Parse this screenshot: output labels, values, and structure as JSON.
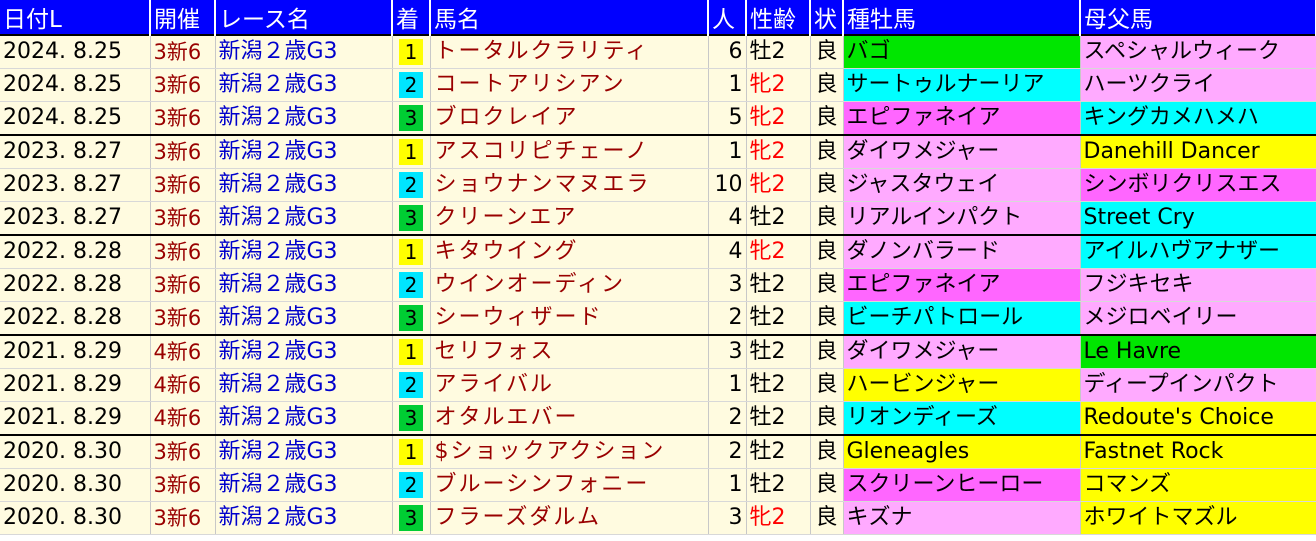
{
  "headers": [
    "日付L",
    "開催",
    "レース名",
    "着",
    "馬名",
    "人",
    "性齢",
    "状",
    "種牡馬",
    "母父馬"
  ],
  "colors": {
    "header_bg": "#0000ff",
    "row_bg": "#fffbe0",
    "rank1": "#ffff00",
    "rank2": "#00e6ff",
    "rank3": "#00cc33",
    "cyan": "#00ffff",
    "pink": "#ffaaff",
    "magenta": "#ff66ff",
    "yellow": "#ffff00",
    "green": "#00e600"
  },
  "rows": [
    {
      "date": "2024. 8.25",
      "kai": "3新6",
      "race": "新潟２歳G3",
      "rank": "1",
      "rank_color": "#ffff00",
      "horse": "トータルクラリティ",
      "pop": "6",
      "sex": "牡2",
      "filly": false,
      "baba": "良",
      "sire": "バゴ",
      "sire_color": "#00e600",
      "dam": "スペシャルウィーク",
      "dam_color": "#ffaaff",
      "grp": true
    },
    {
      "date": "2024. 8.25",
      "kai": "3新6",
      "race": "新潟２歳G3",
      "rank": "2",
      "rank_color": "#00e6ff",
      "horse": "コートアリシアン",
      "pop": "1",
      "sex": "牝2",
      "filly": true,
      "baba": "良",
      "sire": "サートゥルナーリア",
      "sire_color": "#00ffff",
      "dam": "ハーツクライ",
      "dam_color": "#ffaaff",
      "grp": false
    },
    {
      "date": "2024. 8.25",
      "kai": "3新6",
      "race": "新潟２歳G3",
      "rank": "3",
      "rank_color": "#00cc33",
      "horse": "ブロクレイア",
      "pop": "5",
      "sex": "牝2",
      "filly": true,
      "baba": "良",
      "sire": "エピファネイア",
      "sire_color": "#ff66ff",
      "dam": "キングカメハメハ",
      "dam_color": "#00ffff",
      "grp": false
    },
    {
      "date": "2023. 8.27",
      "kai": "3新6",
      "race": "新潟２歳G3",
      "rank": "1",
      "rank_color": "#ffff00",
      "horse": "アスコリピチェーノ",
      "pop": "1",
      "sex": "牝2",
      "filly": true,
      "baba": "良",
      "sire": "ダイワメジャー",
      "sire_color": "#ffaaff",
      "dam": "Danehill Dancer",
      "dam_color": "#ffff00",
      "grp": true
    },
    {
      "date": "2023. 8.27",
      "kai": "3新6",
      "race": "新潟２歳G3",
      "rank": "2",
      "rank_color": "#00e6ff",
      "horse": "ショウナンマヌエラ",
      "pop": "10",
      "sex": "牝2",
      "filly": true,
      "baba": "良",
      "sire": "ジャスタウェイ",
      "sire_color": "#ffaaff",
      "dam": "シンボリクリスエス",
      "dam_color": "#ff66ff",
      "grp": false
    },
    {
      "date": "2023. 8.27",
      "kai": "3新6",
      "race": "新潟２歳G3",
      "rank": "3",
      "rank_color": "#00cc33",
      "horse": "クリーンエア",
      "pop": "4",
      "sex": "牡2",
      "filly": false,
      "baba": "良",
      "sire": "リアルインパクト",
      "sire_color": "#ffaaff",
      "dam": "Street Cry",
      "dam_color": "#00ffff",
      "grp": false
    },
    {
      "date": "2022. 8.28",
      "kai": "3新6",
      "race": "新潟２歳G3",
      "rank": "1",
      "rank_color": "#ffff00",
      "horse": "キタウイング",
      "pop": "4",
      "sex": "牝2",
      "filly": true,
      "baba": "良",
      "sire": "ダノンバラード",
      "sire_color": "#ffaaff",
      "dam": "アイルハヴアナザー",
      "dam_color": "#00ffff",
      "grp": true
    },
    {
      "date": "2022. 8.28",
      "kai": "3新6",
      "race": "新潟２歳G3",
      "rank": "2",
      "rank_color": "#00e6ff",
      "horse": "ウインオーディン",
      "pop": "3",
      "sex": "牡2",
      "filly": false,
      "baba": "良",
      "sire": "エピファネイア",
      "sire_color": "#ff66ff",
      "dam": "フジキセキ",
      "dam_color": "#ffaaff",
      "grp": false
    },
    {
      "date": "2022. 8.28",
      "kai": "3新6",
      "race": "新潟２歳G3",
      "rank": "3",
      "rank_color": "#00cc33",
      "horse": "シーウィザード",
      "pop": "2",
      "sex": "牡2",
      "filly": false,
      "baba": "良",
      "sire": "ビーチパトロール",
      "sire_color": "#00ffff",
      "dam": "メジロベイリー",
      "dam_color": "#ffaaff",
      "grp": false
    },
    {
      "date": "2021. 8.29",
      "kai": "4新6",
      "race": "新潟２歳G3",
      "rank": "1",
      "rank_color": "#ffff00",
      "horse": "セリフォス",
      "pop": "3",
      "sex": "牡2",
      "filly": false,
      "baba": "良",
      "sire": "ダイワメジャー",
      "sire_color": "#ffaaff",
      "dam": "Le Havre",
      "dam_color": "#00e600",
      "grp": true
    },
    {
      "date": "2021. 8.29",
      "kai": "4新6",
      "race": "新潟２歳G3",
      "rank": "2",
      "rank_color": "#00e6ff",
      "horse": "アライバル",
      "pop": "1",
      "sex": "牡2",
      "filly": false,
      "baba": "良",
      "sire": "ハービンジャー",
      "sire_color": "#ffff00",
      "dam": "ディープインパクト",
      "dam_color": "#ffaaff",
      "grp": false
    },
    {
      "date": "2021. 8.29",
      "kai": "4新6",
      "race": "新潟２歳G3",
      "rank": "3",
      "rank_color": "#00cc33",
      "horse": "オタルエバー",
      "pop": "2",
      "sex": "牡2",
      "filly": false,
      "baba": "良",
      "sire": "リオンディーズ",
      "sire_color": "#00ffff",
      "dam": "Redoute's Choice",
      "dam_color": "#ffff00",
      "grp": false
    },
    {
      "date": "2020. 8.30",
      "kai": "3新6",
      "race": "新潟２歳G3",
      "rank": "1",
      "rank_color": "#ffff00",
      "horse": "$ショックアクション",
      "pop": "2",
      "sex": "牡2",
      "filly": false,
      "baba": "良",
      "sire": "Gleneagles",
      "sire_color": "#ffff00",
      "dam": "Fastnet Rock",
      "dam_color": "#ffff00",
      "grp": true
    },
    {
      "date": "2020. 8.30",
      "kai": "3新6",
      "race": "新潟２歳G3",
      "rank": "2",
      "rank_color": "#00e6ff",
      "horse": "ブルーシンフォニー",
      "pop": "1",
      "sex": "牡2",
      "filly": false,
      "baba": "良",
      "sire": "スクリーンヒーロー",
      "sire_color": "#ff66ff",
      "dam": "コマンズ",
      "dam_color": "#ffff00",
      "grp": false
    },
    {
      "date": "2020. 8.30",
      "kai": "3新6",
      "race": "新潟２歳G3",
      "rank": "3",
      "rank_color": "#00cc33",
      "horse": "フラーズダルム",
      "pop": "3",
      "sex": "牝2",
      "filly": true,
      "baba": "良",
      "sire": "キズナ",
      "sire_color": "#ffaaff",
      "dam": "ホワイトマズル",
      "dam_color": "#ffff00",
      "grp": false
    }
  ]
}
